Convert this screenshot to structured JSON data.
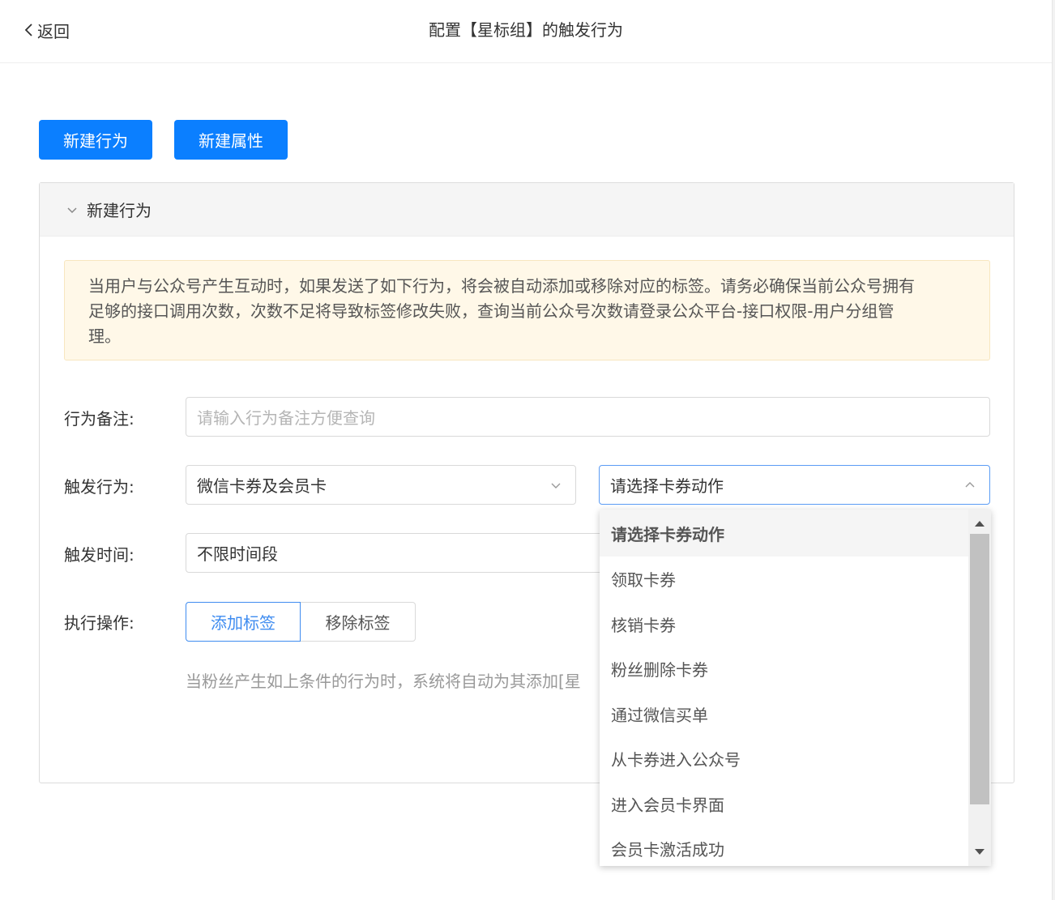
{
  "header": {
    "back_label": "返回",
    "title": "配置【星标组】的触发行为"
  },
  "toolbar": {
    "new_behavior_label": "新建行为",
    "new_attribute_label": "新建属性"
  },
  "panel": {
    "title": "新建行为",
    "notice": "当用户与公众号产生互动时，如果发送了如下行为，将会被自动添加或移除对应的标签。请务必确保当前公众号拥有足够的接口调用次数，次数不足将导致标签修改失败，查询当前公众号次数请登录公众平台-接口权限-用户分组管理。"
  },
  "form": {
    "remark_label": "行为备注:",
    "remark_placeholder": "请输入行为备注方便查询",
    "trigger_label": "触发行为:",
    "trigger_value": "微信卡券及会员卡",
    "card_action_placeholder": "请选择卡券动作",
    "time_label": "触发时间:",
    "time_value": "不限时间段",
    "operation_label": "执行操作:",
    "add_tag_label": "添加标签",
    "remove_tag_label": "移除标签",
    "hint": "当粉丝产生如上条件的行为时，系统将自动为其添加[星"
  },
  "dropdown": {
    "options": [
      "请选择卡券动作",
      "领取卡券",
      "核销卡券",
      "粉丝删除卡券",
      "通过微信买单",
      "从卡券进入公众号",
      "进入会员卡界面",
      "会员卡激活成功"
    ]
  },
  "colors": {
    "primary": "#0b7fff",
    "focus": "#3f8cf0",
    "notice_bg": "#fff8e8"
  }
}
